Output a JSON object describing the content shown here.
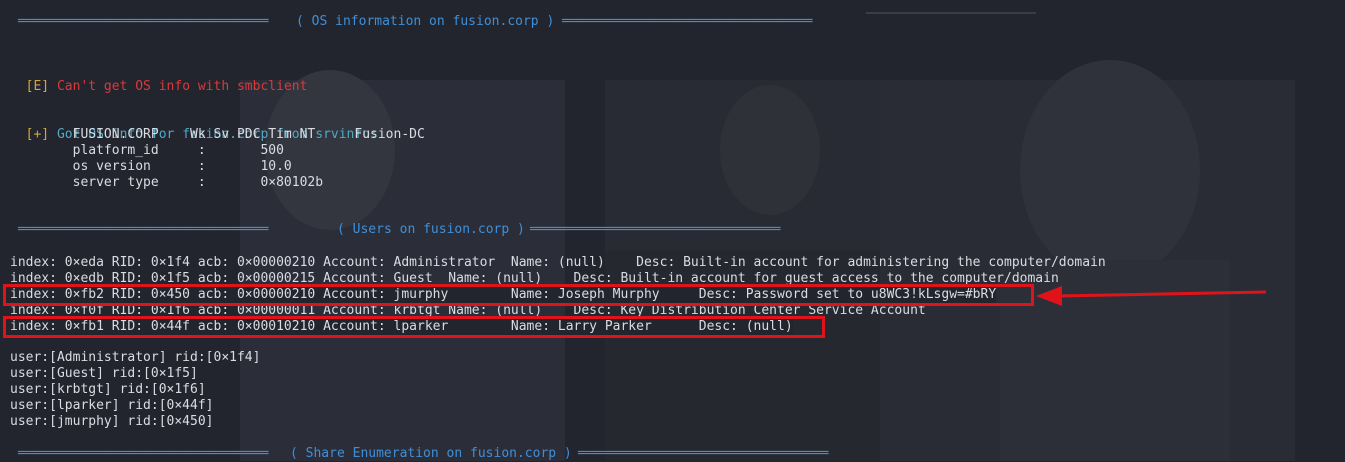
{
  "sections": {
    "os_title": "( OS information on fusion.corp )",
    "users_title": "( Users on fusion.corp )",
    "share_title": "( Share Enumeration on fusion.corp )",
    "rule_char": "════════════════════════════════"
  },
  "os": {
    "error_tag": "[E]",
    "error_msg": " Can't get OS info with smbclient",
    "ok_tag": "[+]",
    "ok_msg": " Got OS info for fusion.corp from srvinfo:",
    "rows": [
      "        FUSION.CORP    Wk Sv PDC Tim NT     Fusion-DC",
      "        platform_id     :       500",
      "        os version      :       10.0",
      "        server type     :       0×80102b"
    ]
  },
  "users": {
    "rows": [
      "index: 0×eda RID: 0×1f4 acb: 0×00000210 Account: Administrator  Name: (null)    Desc: Built-in account for administering the computer/domain",
      "index: 0×edb RID: 0×1f5 acb: 0×00000215 Account: Guest  Name: (null)    Desc: Built-in account for guest access to the computer/domain",
      "index: 0×fb2 RID: 0×450 acb: 0×00000210 Account: jmurphy        Name: Joseph Murphy     Desc: Password set to u8WC3!kLsgw=#bRY",
      "index: 0×f0f RID: 0×1f6 acb: 0×00000011 Account: krbtgt Name: (null)    Desc: Key Distribution Center Service Account",
      "index: 0×fb1 RID: 0×44f acb: 0×00010210 Account: lparker        Name: Larry Parker      Desc: (null)"
    ],
    "list": [
      "user:[Administrator] rid:[0×1f4]",
      "user:[Guest] rid:[0×1f5]",
      "user:[krbtgt] rid:[0×1f6]",
      "user:[lparker] rid:[0×44f]",
      "user:[jmurphy] rid:[0×450]"
    ]
  },
  "colors": {
    "highlight": "#e0131a",
    "section": "#3f8fd8",
    "error": "#d93a3a",
    "info": "#4fa9c4"
  }
}
